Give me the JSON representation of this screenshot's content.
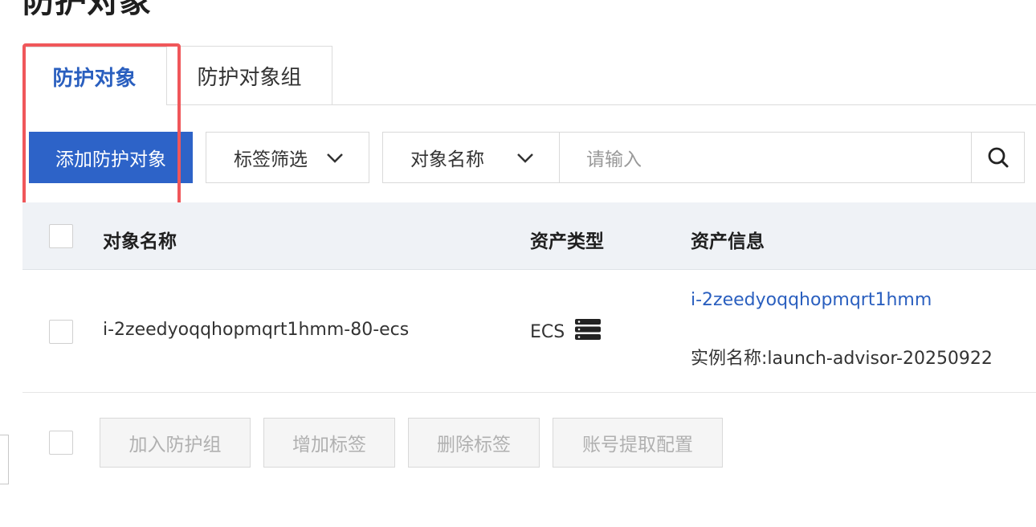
{
  "page": {
    "title": "防护对象"
  },
  "tabs": [
    {
      "label": "防护对象",
      "active": true
    },
    {
      "label": "防护对象组",
      "active": false
    }
  ],
  "toolbar": {
    "add_button": "添加防护对象",
    "tag_filter": "标签筛选",
    "field_select": "对象名称",
    "search_placeholder": "请输入"
  },
  "table": {
    "columns": [
      "对象名称",
      "资产类型",
      "资产信息"
    ],
    "rows": [
      {
        "name": "i-2zeedyoqqhopmqrt1hmm-80-ecs",
        "asset_type": "ECS",
        "asset_type_icon": "server-icon",
        "asset_id": "i-2zeedyoqqhopmqrt1hmm",
        "instance_name": "实例名称:launch-advisor-20250922"
      }
    ]
  },
  "bulk_actions": [
    "加入防护组",
    "增加标签",
    "删除标签",
    "账号提取配置"
  ],
  "colors": {
    "primary": "#2d63c8",
    "link": "#2a5fbf",
    "highlight": "#f0575a"
  }
}
